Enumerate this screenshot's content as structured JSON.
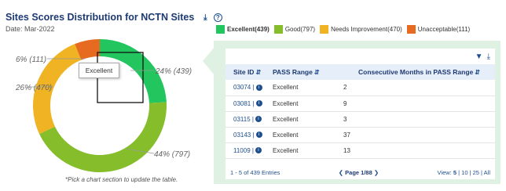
{
  "header": {
    "title": "Sites Scores Distribution for NCTN Sites",
    "date": "Date: Mar-2022",
    "note": "*Pick a chart section to update the table."
  },
  "chart_data": {
    "type": "pie",
    "categories": [
      "Excellent",
      "Good",
      "Needs Improvement",
      "Unacceptable"
    ],
    "values": [
      439,
      797,
      470,
      111
    ],
    "percent_labels": [
      "24% (439)",
      "44% (797)",
      "26% (470)",
      "6% (111)"
    ],
    "colors": [
      "#22c55e",
      "#86bd2a",
      "#f0b323",
      "#e66a1f"
    ],
    "tooltip": "Excellent"
  },
  "legend": [
    {
      "label": "Excellent(439)",
      "color": "#22c55e",
      "selected": true
    },
    {
      "label": "Good(797)",
      "color": "#86bd2a",
      "selected": false
    },
    {
      "label": "Needs Improvement(470)",
      "color": "#f0b323",
      "selected": false
    },
    {
      "label": "Unacceptable(111)",
      "color": "#e66a1f",
      "selected": false
    }
  ],
  "table": {
    "headers": [
      "Site ID",
      "PASS Range",
      "Consecutive Months in PASS Range"
    ],
    "rows": [
      {
        "site": "03074 |",
        "range": "Excellent",
        "months": "2"
      },
      {
        "site": "03081 |",
        "range": "Excellent",
        "months": "9"
      },
      {
        "site": "03115 |",
        "range": "Excellent",
        "months": "3"
      },
      {
        "site": "03143 |",
        "range": "Excellent",
        "months": "37"
      },
      {
        "site": "11009 |",
        "range": "Excellent",
        "months": "13"
      }
    ],
    "entries": "1 - 5 of 439 Entries",
    "page": "Page 1/88",
    "view_label": "View:",
    "view_selected": "5",
    "view_options": "| 10 | 25 | All"
  },
  "icons": {
    "download": "download-icon",
    "help": "question-circle-icon",
    "filter": "filter-icon",
    "info": "info-icon",
    "sort": "sort-icon"
  }
}
